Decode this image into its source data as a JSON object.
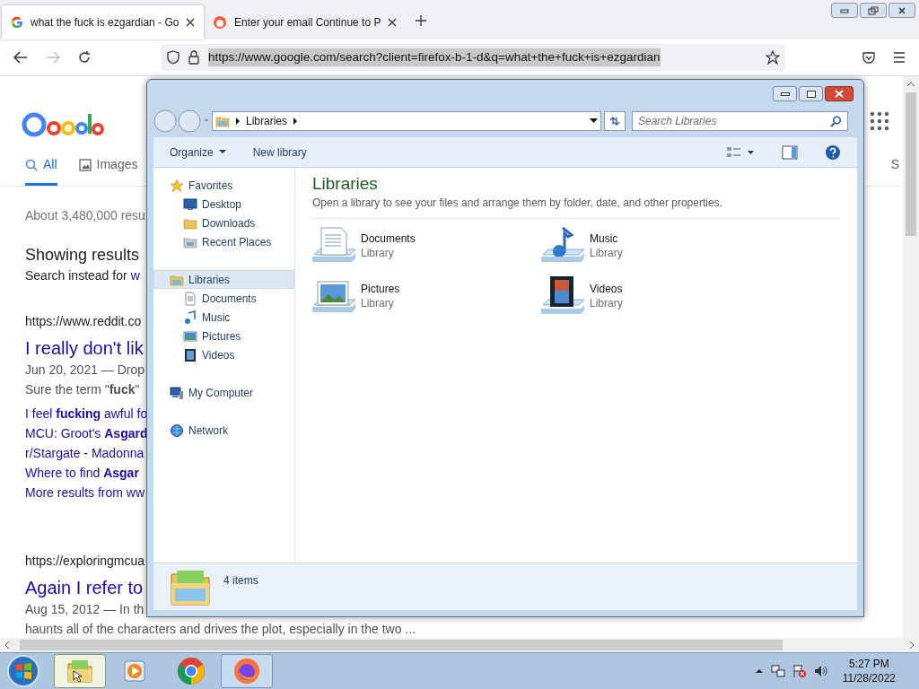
{
  "browser": {
    "tabs": [
      {
        "title": "what the fuck is ezgardian - Go",
        "selected": true,
        "kind": "google"
      },
      {
        "title": "Enter your email Continue to P",
        "selected": false,
        "kind": "firefox"
      }
    ],
    "url": "https://www.google.com/search?client=firefox-b-1-d&q=what+the+fuck+is+ezgardian"
  },
  "google": {
    "tabs": [
      {
        "label": "All",
        "selected": true,
        "kind": "search"
      },
      {
        "label": "Images",
        "selected": false,
        "kind": "image"
      }
    ],
    "right_tab": "S",
    "stats": "About 3,480,000 resu",
    "showing": "Showing results",
    "search_instead": {
      "text": "Search instead for",
      "link": "w"
    },
    "results": [
      {
        "url": "https://www.reddit.co",
        "title": "I really don't lik",
        "snippet": [
          "Jun 20, 2021 — Drop",
          "Sure the term \"**fuck**\""
        ],
        "links": [
          "I feel **fucking** awful fo",
          "MCU: Groot's **Asgard**",
          "r/Stargate - Madonna",
          "Where to find **Asgar**",
          "More results from ww"
        ]
      },
      {
        "url": "https://exploringmcua",
        "title": "Again I refer to",
        "snippet": [
          "Aug 15, 2012 — In th",
          "haunts all of the characters and drives the plot, especially in the two ..."
        ]
      }
    ]
  },
  "explorer": {
    "breadcrumb": "Libraries",
    "search_placeholder": "Search Libraries",
    "toolbar": [
      "Organize",
      "New library"
    ],
    "nav": [
      {
        "label": "Favorites",
        "kind": "star",
        "selected": false,
        "children": [
          {
            "label": "Desktop",
            "kind": "desktop",
            "selected": false
          },
          {
            "label": "Downloads",
            "kind": "folder",
            "selected": false
          },
          {
            "label": "Recent Places",
            "kind": "recent",
            "selected": false
          }
        ]
      },
      {
        "label": "Libraries",
        "kind": "library",
        "selected": true,
        "children": [
          {
            "label": "Documents",
            "kind": "document",
            "selected": false
          },
          {
            "label": "Music",
            "kind": "music",
            "selected": false
          },
          {
            "label": "Pictures",
            "kind": "picture",
            "selected": false
          },
          {
            "label": "Videos",
            "kind": "video",
            "selected": false
          }
        ]
      },
      {
        "label": "My Computer",
        "kind": "computer",
        "selected": false
      },
      {
        "label": "Network",
        "kind": "network",
        "selected": false
      }
    ],
    "heading": "Libraries",
    "description": "Open a library to see your files and arrange them by folder, date, and other properties.",
    "items": [
      {
        "name": "Documents",
        "type": "Library",
        "kind": "document"
      },
      {
        "name": "Music",
        "type": "Library",
        "kind": "music"
      },
      {
        "name": "Pictures",
        "type": "Library",
        "kind": "picture"
      },
      {
        "name": "Videos",
        "type": "Library",
        "kind": "video"
      }
    ],
    "status": "4 items"
  },
  "taskbar": {
    "apps": [
      {
        "kind": "explorer",
        "selected": true
      },
      {
        "kind": "media",
        "selected": false
      },
      {
        "kind": "chrome",
        "selected": false
      },
      {
        "kind": "firefox",
        "selected": true
      }
    ],
    "time": "5:27 PM",
    "date": "11/28/2022"
  }
}
